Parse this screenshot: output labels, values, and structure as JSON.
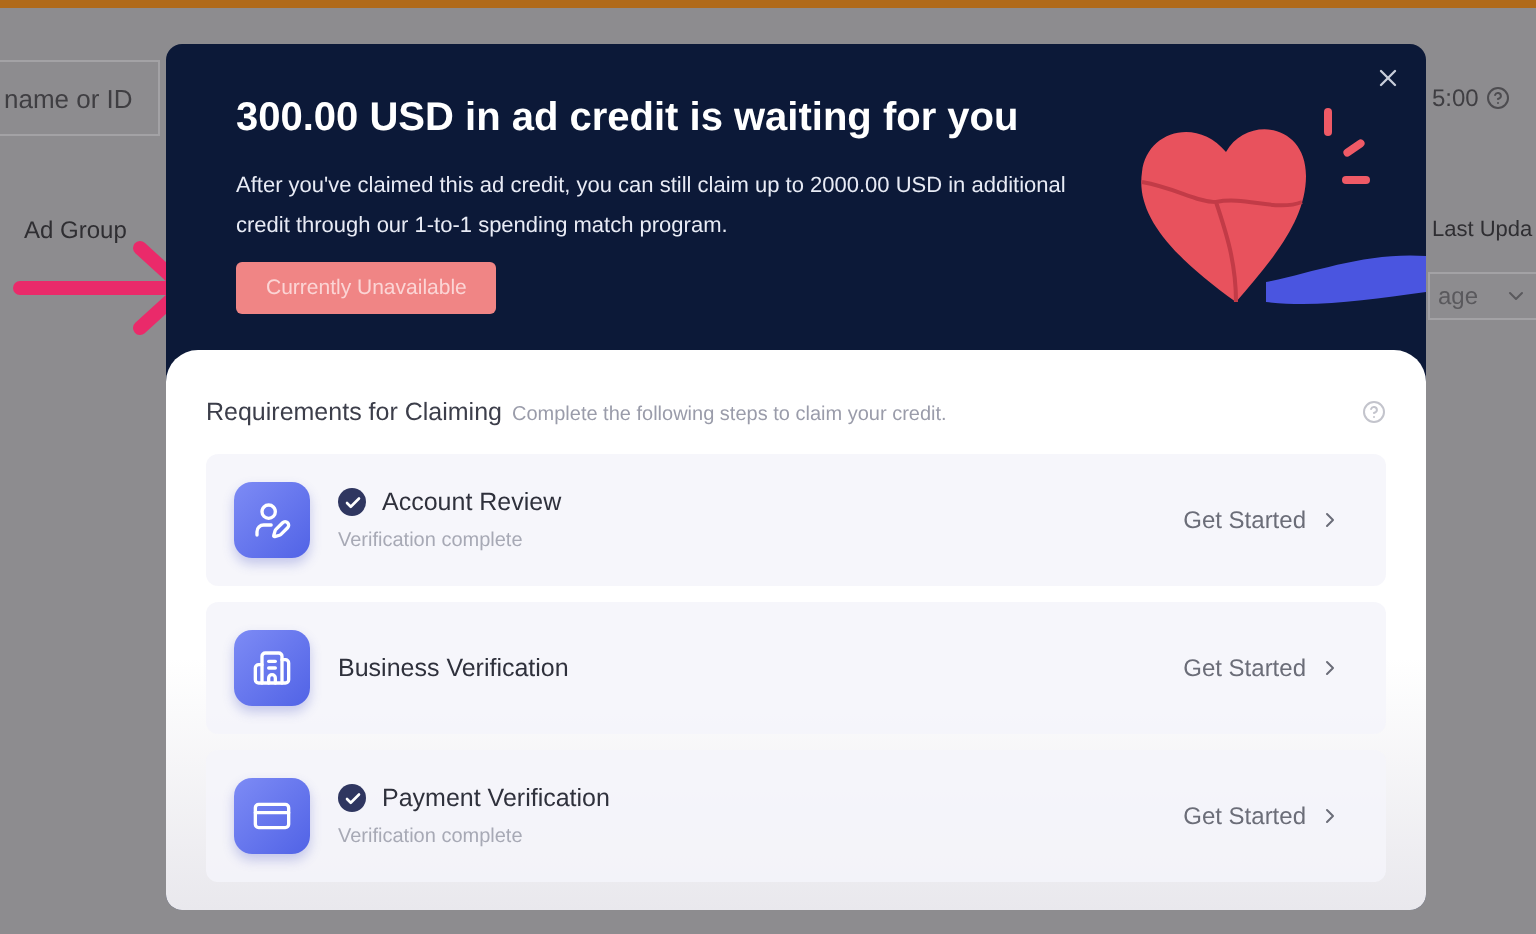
{
  "background_page": {
    "search_placeholder": "name or ID",
    "time_text": "5:00",
    "column_1": "Ad Group",
    "column_2": "Last Upda",
    "dropdown_value": "age"
  },
  "modal": {
    "title": "300.00 USD in ad credit is waiting for you",
    "description": "After you've claimed this ad credit, you can still claim up to 2000.00 USD in additional credit through our 1-to-1 spending match program.",
    "button": {
      "label": "Currently Unavailable",
      "disabled": true
    },
    "requirements_title": "Requirements for Claiming",
    "requirements_hint": "Complete the following steps to claim your credit.",
    "steps": [
      {
        "kind": "account",
        "title": "Account Review",
        "completed": true,
        "status": "Verification complete",
        "action": "Get Started"
      },
      {
        "kind": "business",
        "title": "Business Verification",
        "completed": false,
        "action": "Get Started"
      },
      {
        "kind": "payment",
        "title": "Payment Verification",
        "completed": true,
        "status": "Verification complete",
        "action": "Get Started"
      }
    ]
  }
}
